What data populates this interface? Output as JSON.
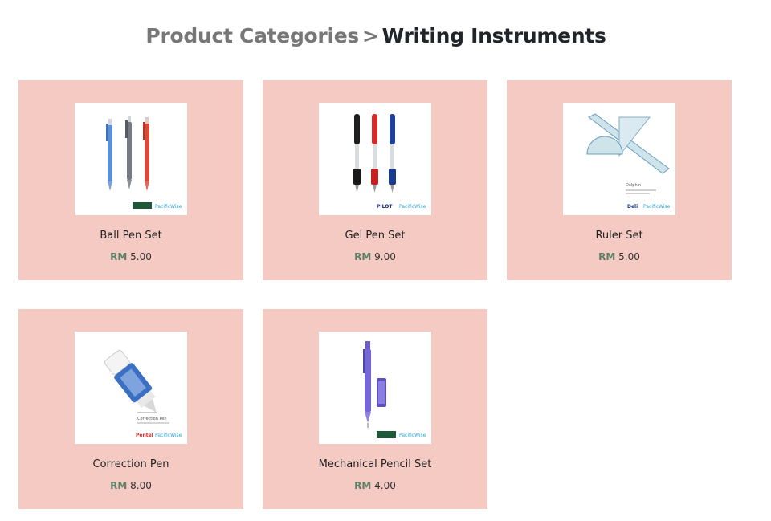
{
  "breadcrumb": {
    "parent": "Product Categories",
    "separator": ">",
    "current": "Writing Instruments"
  },
  "products": [
    {
      "name": "Ball Pen Set",
      "currency": "RM",
      "price": "5.00",
      "icon": "ball-pen-set-image"
    },
    {
      "name": "Gel Pen Set",
      "currency": "RM",
      "price": "9.00",
      "icon": "gel-pen-set-image"
    },
    {
      "name": "Ruler Set",
      "currency": "RM",
      "price": "5.00",
      "icon": "ruler-set-image"
    },
    {
      "name": "Correction Pen",
      "currency": "RM",
      "price": "8.00",
      "icon": "correction-pen-image"
    },
    {
      "name": "Mechanical Pencil Set",
      "currency": "RM",
      "price": "4.00",
      "icon": "mechanical-pencil-set-image"
    }
  ],
  "image_text": {
    "brand_logo": "PacificWise",
    "gel_brand": "PILOT",
    "ruler_brand": "Deli",
    "ruler_product": "Dolphin",
    "correction_title": "Correction Pen",
    "correction_brand": "Pentel"
  },
  "colors": {
    "card_background": "#f5cac3",
    "currency": "#5e7f66",
    "breadcrumb_parent": "#777777",
    "breadcrumb_current": "#212529"
  }
}
